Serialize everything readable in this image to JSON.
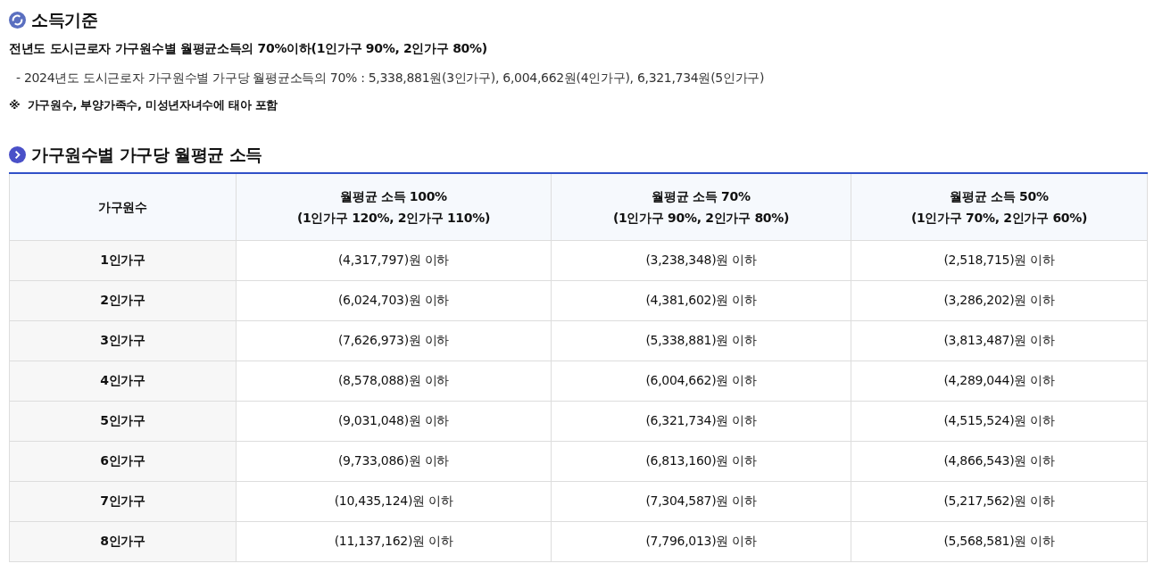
{
  "criteria": {
    "title": "소득기준",
    "main_text": "전년도 도시근로자 가구원수별 월평균소득의 70%이하(1인가구 90%, 2인가구 80%)",
    "detail_text": "- 2024년도 도시근로자 가구원수별 가구당 월평균소득의 70% : 5,338,881원(3인가구), 6,004,662원(4인가구), 6,321,734원(5인가구)",
    "note": "※  가구원수, 부양가족수, 미성년자녀수에 태아 포함"
  },
  "income_table": {
    "title": "가구원수별 가구당 월평균 소득",
    "columns": [
      {
        "lines": [
          "가구원수"
        ]
      },
      {
        "lines": [
          "월평균 소득 100%",
          "(1인가구 120%, 2인가구 110%)"
        ]
      },
      {
        "lines": [
          "월평균 소득 70%",
          "(1인가구 90%, 2인가구 80%)"
        ]
      },
      {
        "lines": [
          "월평균 소득 50%",
          "(1인가구 70%, 2인가구 60%)"
        ]
      }
    ],
    "rows": [
      [
        "1인가구",
        "(4,317,797)원 이하",
        "(3,238,348)원 이하",
        "(2,518,715)원 이하"
      ],
      [
        "2인가구",
        "(6,024,703)원 이하",
        "(4,381,602)원 이하",
        "(3,286,202)원 이하"
      ],
      [
        "3인가구",
        "(7,626,973)원 이하",
        "(5,338,881)원 이하",
        "(3,813,487)원 이하"
      ],
      [
        "4인가구",
        "(8,578,088)원 이하",
        "(6,004,662)원 이하",
        "(4,289,044)원 이하"
      ],
      [
        "5인가구",
        "(9,031,048)원 이하",
        "(6,321,734)원 이하",
        "(4,515,524)원 이하"
      ],
      [
        "6인가구",
        "(9,733,086)원 이하",
        "(6,813,160)원 이하",
        "(4,866,543)원 이하"
      ],
      [
        "7인가구",
        "(10,435,124)원 이하",
        "(7,304,587)원 이하",
        "(5,217,562)원 이하"
      ],
      [
        "8인가구",
        "(11,137,162)원 이하",
        "(7,796,013)원 이하",
        "(5,568,581)원 이하"
      ]
    ]
  }
}
